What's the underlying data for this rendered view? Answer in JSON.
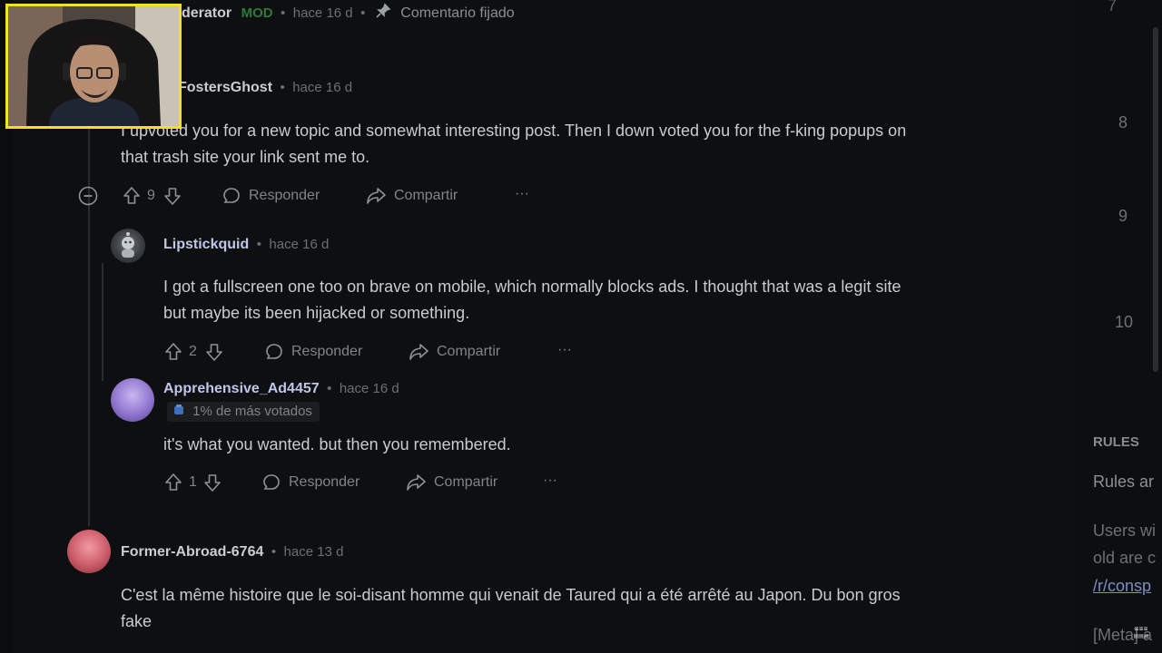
{
  "pinned": {
    "username_fragment": "derator",
    "mod_badge": "MOD",
    "time": "hace 16 d",
    "pinned_label": "Comentario fijado"
  },
  "comments": [
    {
      "username": "FostersGhost",
      "time": "hace 16 d",
      "text_line1": "I upvoted you for a new topic and somewhat interesting post. Then I down voted you for the f-king popups on",
      "text_line2": "that trash site your link sent me to.",
      "votes": "9",
      "reply": "Responder",
      "share": "Compartir",
      "more": "···"
    },
    {
      "username": "Lipstickquid",
      "time": "hace 16 d",
      "text_line1": "I got a fullscreen one too on brave on mobile, which normally blocks ads. I thought that was a legit site",
      "text_line2": "but maybe its been hijacked or something.",
      "votes": "2",
      "reply": "Responder",
      "share": "Compartir",
      "more": "···"
    },
    {
      "username": "Apprehensive_Ad4457",
      "time": "hace 16 d",
      "flair": "1% de más votados",
      "text_line1": "it's what you wanted. but then you remembered.",
      "votes": "1",
      "reply": "Responder",
      "share": "Compartir",
      "more": "···"
    },
    {
      "username": "Former-Abroad-6764",
      "time": "hace 13 d",
      "text_line1": "C'est la même histoire que le soi-disant homme qui venait de Taured qui a été arrêté au Japon. Du bon gros",
      "text_line2": "fake"
    }
  ],
  "sidebar": {
    "numbers": [
      "7",
      "8",
      "9",
      "10"
    ],
    "rules_heading": "RULES",
    "rules_text": "Rules ar",
    "users_text1": "Users wi",
    "users_text2": "old are c",
    "link_text": "/r/consp",
    "meta_text": "[Meta] a"
  },
  "separator": "•",
  "colors": {
    "webcam_border": "#f2e21c",
    "mod_green": "#2f7a3b",
    "background": "#0e0f10"
  }
}
